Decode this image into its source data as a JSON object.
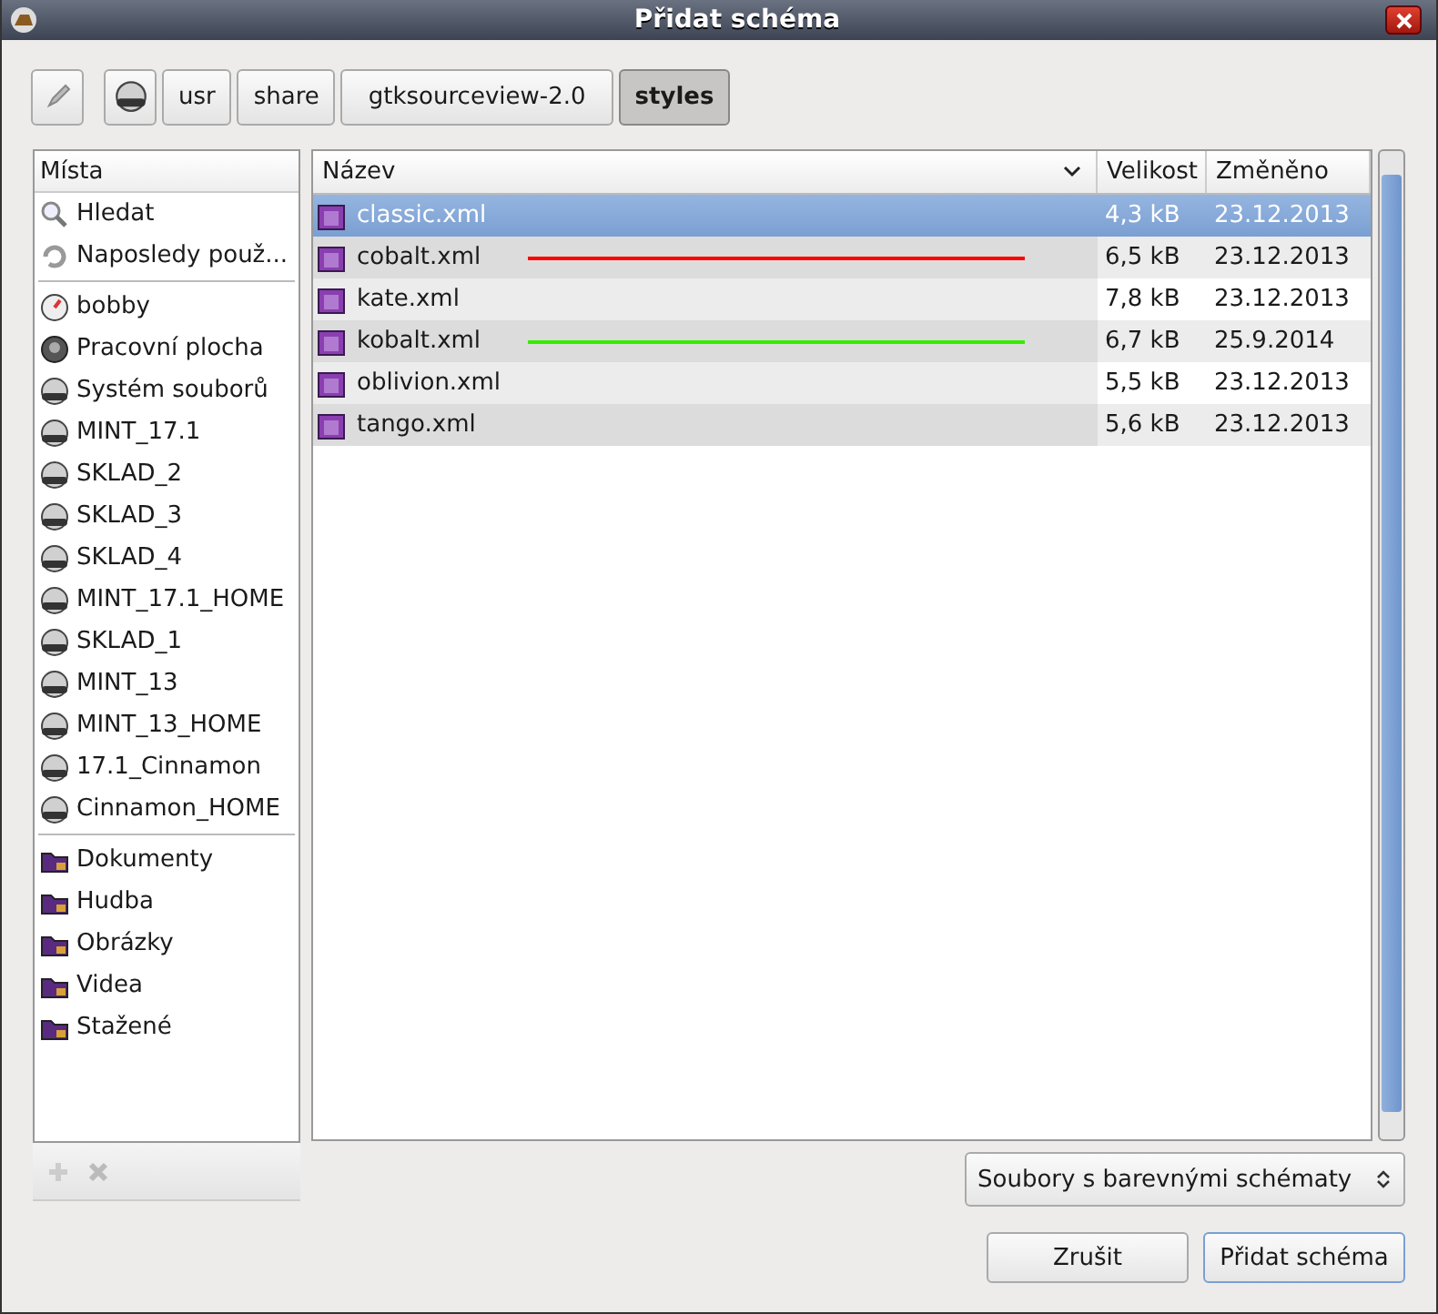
{
  "window": {
    "title": "Přidat schéma"
  },
  "path_bar": [
    {
      "label": "usr",
      "selected": false
    },
    {
      "label": "share",
      "selected": false
    },
    {
      "label": "gtksourceview-2.0",
      "selected": false
    },
    {
      "label": "styles",
      "selected": true
    }
  ],
  "places": {
    "heading": "Místa",
    "sections": [
      {
        "items": [
          {
            "label": "Hledat",
            "kind": "search"
          },
          {
            "label": "Naposledy použ...",
            "kind": "recent"
          }
        ]
      },
      {
        "items": [
          {
            "label": "bobby",
            "kind": "home"
          },
          {
            "label": "Pracovní plocha",
            "kind": "desktop"
          },
          {
            "label": "Systém souborů",
            "kind": "drive"
          },
          {
            "label": "MINT_17.1",
            "kind": "drive"
          },
          {
            "label": "SKLAD_2",
            "kind": "drive"
          },
          {
            "label": "SKLAD_3",
            "kind": "drive"
          },
          {
            "label": "SKLAD_4",
            "kind": "drive"
          },
          {
            "label": "MINT_17.1_HOME",
            "kind": "drive"
          },
          {
            "label": "SKLAD_1",
            "kind": "drive"
          },
          {
            "label": "MINT_13",
            "kind": "drive"
          },
          {
            "label": "MINT_13_HOME",
            "kind": "drive"
          },
          {
            "label": "17.1_Cinnamon",
            "kind": "drive"
          },
          {
            "label": "Cinnamon_HOME",
            "kind": "drive"
          }
        ]
      },
      {
        "items": [
          {
            "label": "Dokumenty",
            "kind": "folder"
          },
          {
            "label": "Hudba",
            "kind": "folder"
          },
          {
            "label": "Obrázky",
            "kind": "folder"
          },
          {
            "label": "Videa",
            "kind": "folder"
          },
          {
            "label": "Stažené",
            "kind": "folder"
          }
        ]
      }
    ]
  },
  "files": {
    "columns": [
      "Název",
      "Velikost",
      "Změněno"
    ],
    "rows": [
      {
        "name": "classic.xml",
        "size": "4,3 kB",
        "modified": "23.12.2013",
        "selected": true
      },
      {
        "name": "cobalt.xml",
        "size": "6,5 kB",
        "modified": "23.12.2013",
        "selected": false,
        "color": "#ff0000"
      },
      {
        "name": "kate.xml",
        "size": "7,8 kB",
        "modified": "23.12.2013",
        "selected": false
      },
      {
        "name": "kobalt.xml",
        "size": "6,7 kB",
        "modified": "25.9.2014",
        "selected": false,
        "color": "#33ee00"
      },
      {
        "name": "oblivion.xml",
        "size": "5,5 kB",
        "modified": "23.12.2013",
        "selected": false
      },
      {
        "name": "tango.xml",
        "size": "5,6 kB",
        "modified": "23.12.2013",
        "selected": false
      }
    ]
  },
  "filter": {
    "value": "Soubory s barevnými schématy"
  },
  "buttons": [
    {
      "label": "Zrušit",
      "default": false
    },
    {
      "label": "Přidat schéma",
      "default": true
    }
  ]
}
